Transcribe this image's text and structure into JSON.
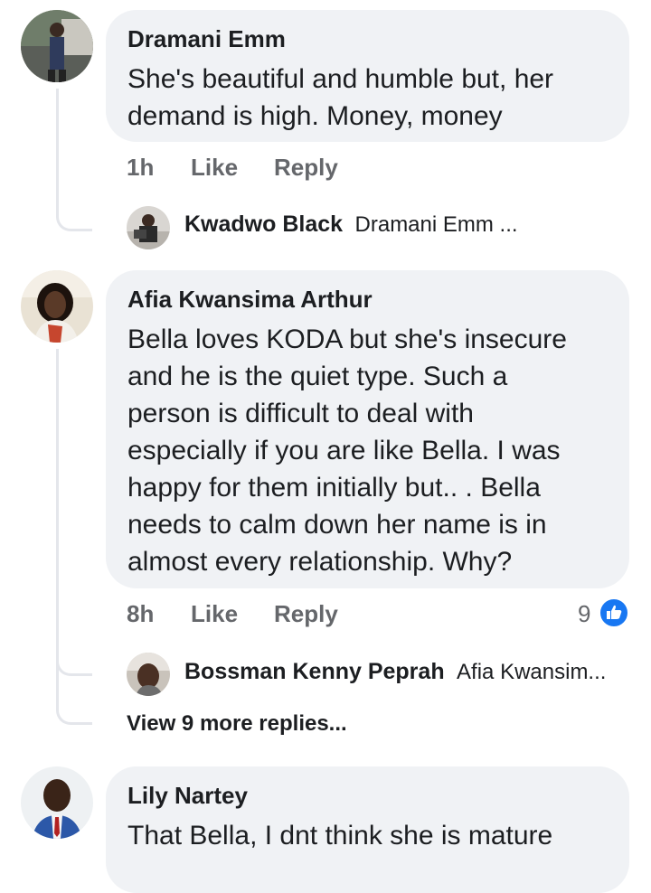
{
  "comments": [
    {
      "author": "Dramani Emm",
      "text": "She's beautiful and humble but, her\ndemand is high. Money, money",
      "time": "1h",
      "like_label": "Like",
      "reply_label": "Reply",
      "reply_preview": {
        "author": "Kwadwo Black",
        "snippet": "Dramani Emm ..."
      }
    },
    {
      "author": "Afia Kwansima Arthur",
      "text": "Bella loves KODA but she's insecure\nand he is the quiet type. Such a\nperson is difficult to deal with\nespecially if you are like Bella. I was\nhappy for them initially but..  . Bella\nneeds to calm down her name is in\nalmost every relationship. Why?",
      "time": "8h",
      "like_label": "Like",
      "reply_label": "Reply",
      "reaction_count": "9",
      "reply_preview": {
        "author": "Bossman Kenny Peprah",
        "snippet": "Afia Kwansim..."
      },
      "view_more": "View 9 more replies..."
    },
    {
      "author": "Lily Nartey",
      "text": "That Bella, I dnt think she is mature"
    }
  ],
  "colors": {
    "bubble": "#f0f2f5",
    "action_text": "#65676b",
    "like_blue": "#1877f2",
    "thread_line": "#e4e6eb"
  },
  "icons": {
    "reaction": "thumbs-up-icon"
  }
}
